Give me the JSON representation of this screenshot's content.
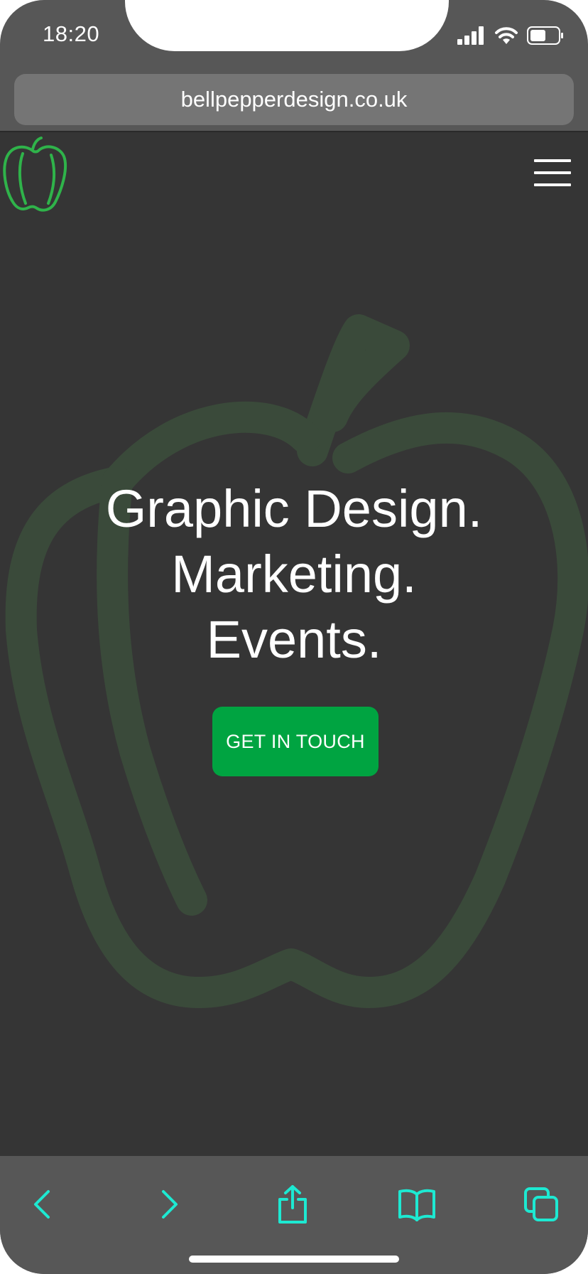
{
  "status_bar": {
    "time": "18:20",
    "icons": [
      "cellular-signal-icon",
      "wifi-icon",
      "battery-icon"
    ]
  },
  "browser": {
    "url": "bellpepperdesign.co.uk",
    "toolbar": [
      "back-icon",
      "forward-icon",
      "share-icon",
      "bookmarks-icon",
      "tabs-icon"
    ]
  },
  "site": {
    "logo": "bell-pepper-logo-icon",
    "menu_icon": "hamburger-menu-icon",
    "hero_lines": [
      "Graphic Design.",
      "Marketing.",
      "Events."
    ],
    "cta_label": "GET IN TOUCH"
  },
  "colors": {
    "accent": "#00a441",
    "toolbar_icons": "#1de9d2",
    "page_background": "#353535",
    "chrome": "#575757",
    "logo_outline": "#2fb34a",
    "watermark": "#3a4a3a"
  }
}
